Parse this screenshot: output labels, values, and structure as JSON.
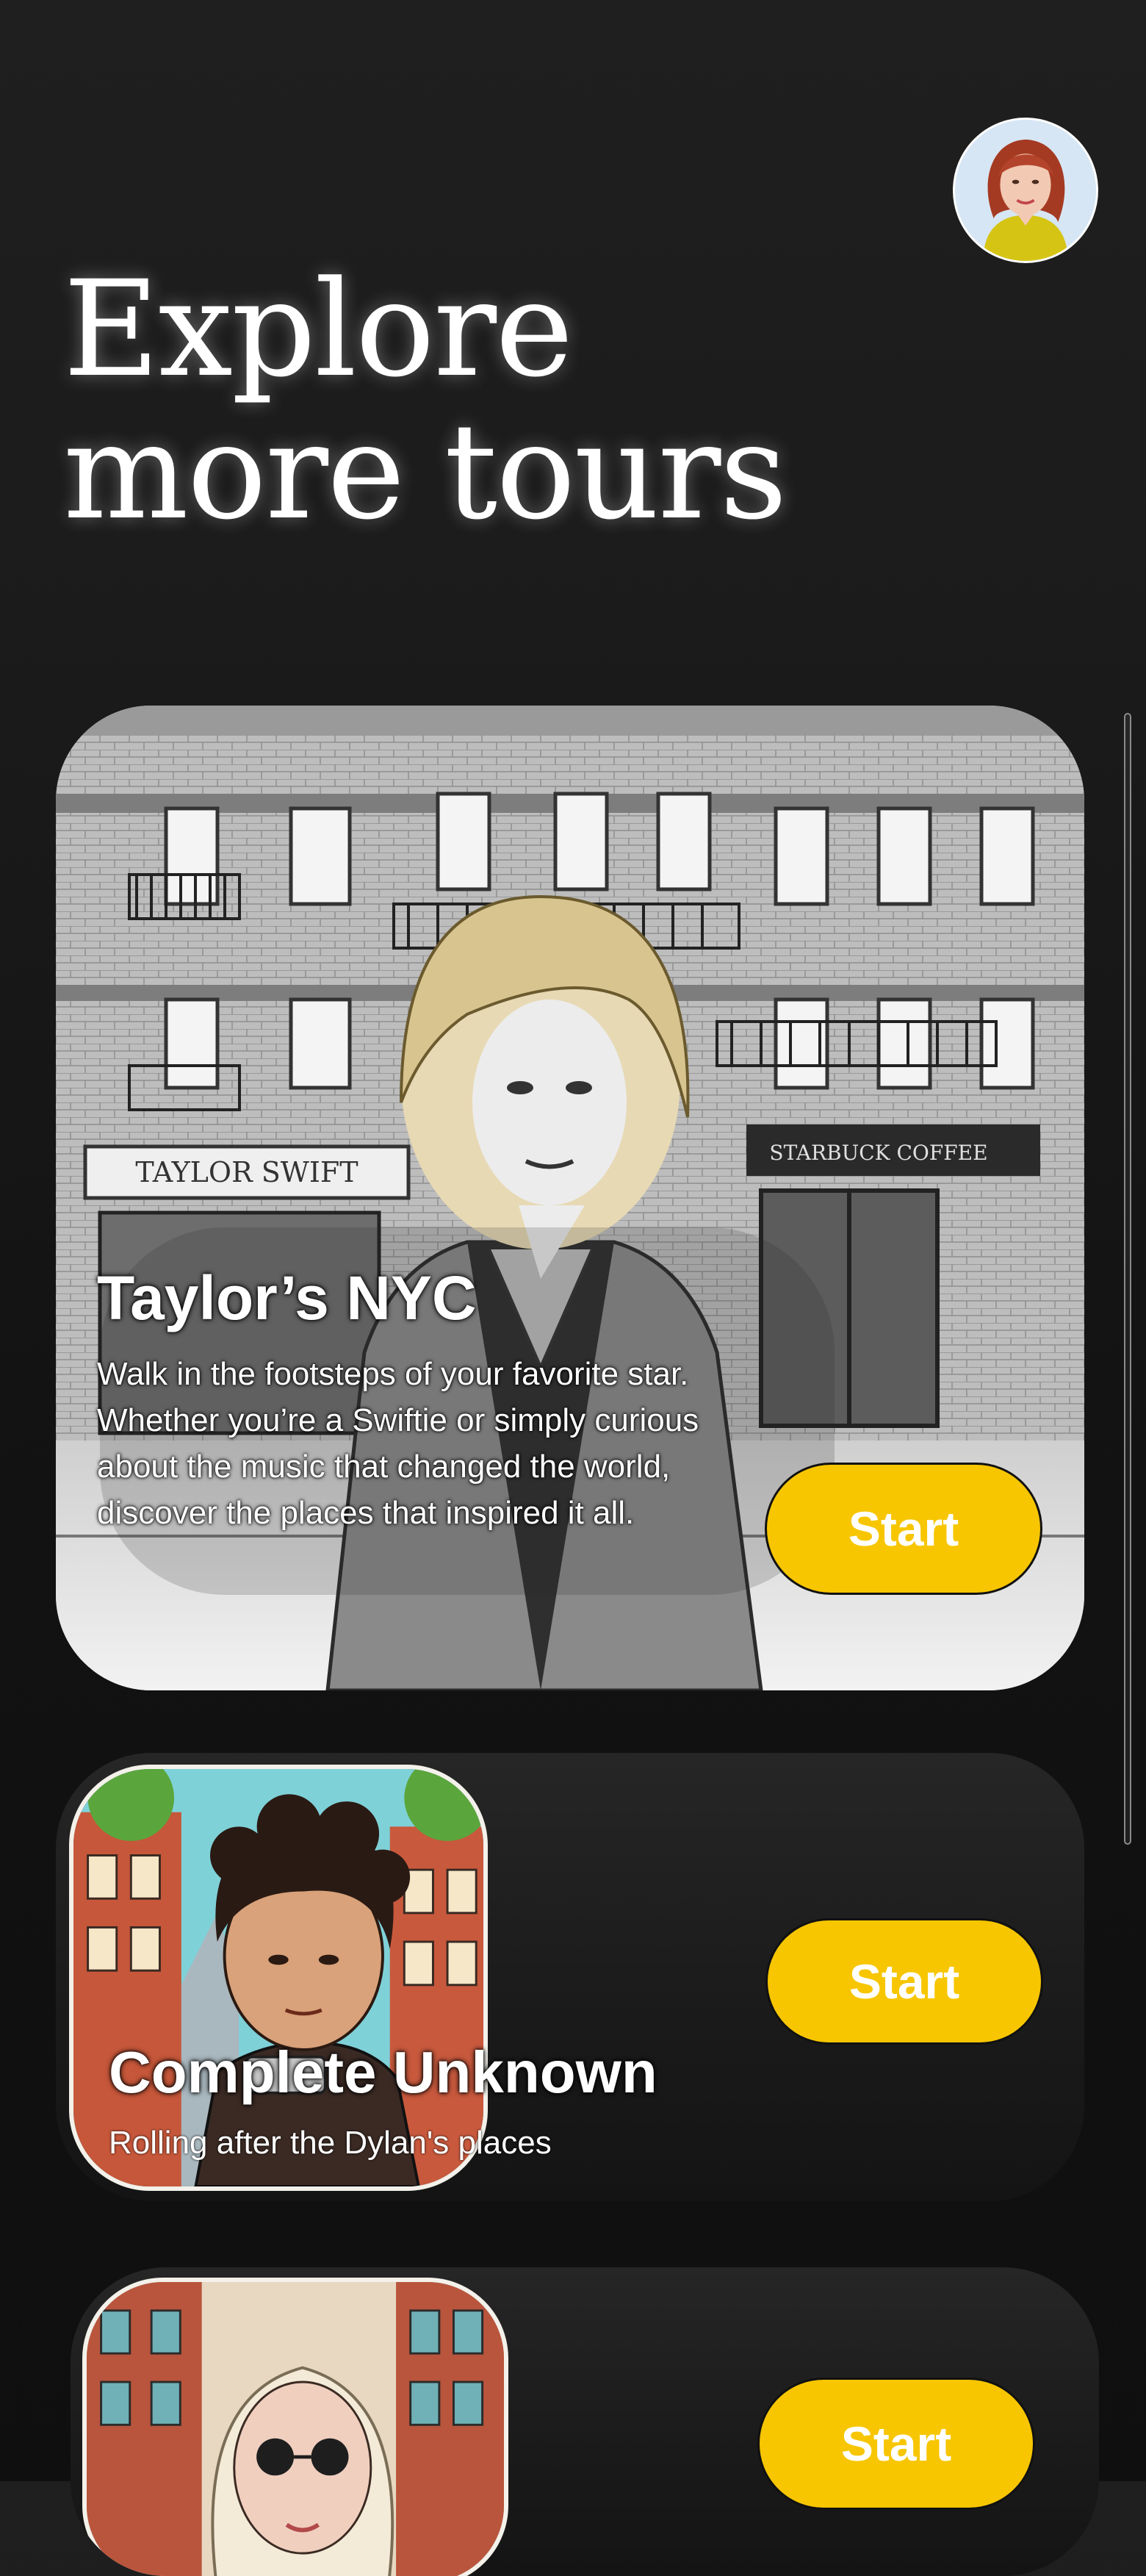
{
  "header": {
    "title_line1": "Explore",
    "title_line2": "more tours",
    "avatar_icon": "user-avatar-icon"
  },
  "tours": [
    {
      "title": "Taylor’s NYC",
      "description": "Walk in the footsteps of your favorite star. Whether you’re a Swiftie or simply curious about the music that changed the world, discover the places that inspired it all.",
      "start_label": "Start",
      "storefront_left": "TAYLOR SWIFT",
      "storefront_right": "STARBUCK COFFEE"
    },
    {
      "title": "Complete Unknown",
      "description": "Rolling after the Dylan's places",
      "start_label": "Start"
    },
    {
      "start_label": "Start"
    }
  ],
  "colors": {
    "accent": "#f7c600",
    "background": "#1a1a1a"
  }
}
